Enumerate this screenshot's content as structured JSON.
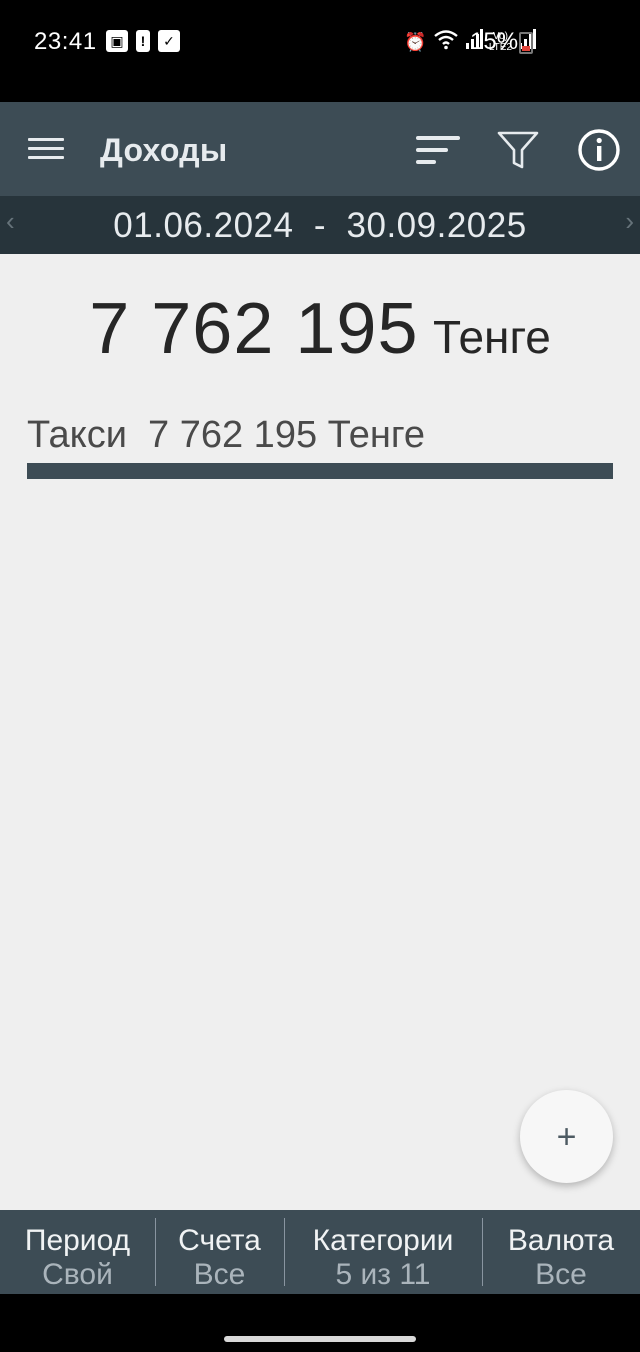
{
  "status_bar": {
    "time": "23:41",
    "battery": "15%"
  },
  "app_bar": {
    "title": "Доходы"
  },
  "date_range": {
    "start": "01.06.2024",
    "end": "30.09.2025",
    "text": "01.06.2024  -  30.09.2025",
    "prev_arrow": "‹",
    "next_arrow": "›"
  },
  "summary": {
    "total_amount": "7 762 195",
    "currency": "Тенге"
  },
  "categories": [
    {
      "label": "Такси  7 762 195 Тенге",
      "name": "Такси",
      "amount": "7 762 195",
      "currency": "Тенге",
      "share": 1.0
    }
  ],
  "fab": {
    "icon": "plus-icon",
    "glyph": "+"
  },
  "bottom_tabs": [
    {
      "title": "Период",
      "value": "Свой"
    },
    {
      "title": "Счета",
      "value": "Все"
    },
    {
      "title": "Категории",
      "value": "5 из 11"
    },
    {
      "title": "Валюта",
      "value": "Все"
    }
  ],
  "colors": {
    "app_bar": "#3d4c55",
    "date_bar": "#27343b",
    "background": "#efefef",
    "category_bar": "#3d4c55",
    "text_primary": "#262626"
  }
}
